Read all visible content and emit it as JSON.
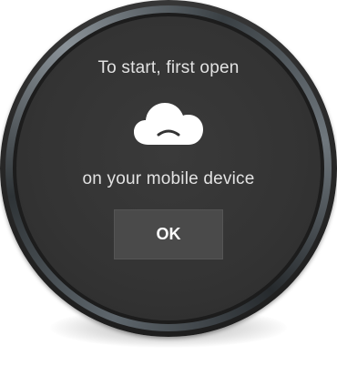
{
  "dialog": {
    "message_top": "To start, first open",
    "message_bottom": "on your mobile device",
    "ok_label": "OK"
  },
  "icons": {
    "app_icon": "cloud-sad-icon"
  },
  "colors": {
    "screen_background": "#333333",
    "text": "#e2e2e2",
    "button_background": "#4a4a4a",
    "button_text": "#ffffff"
  }
}
